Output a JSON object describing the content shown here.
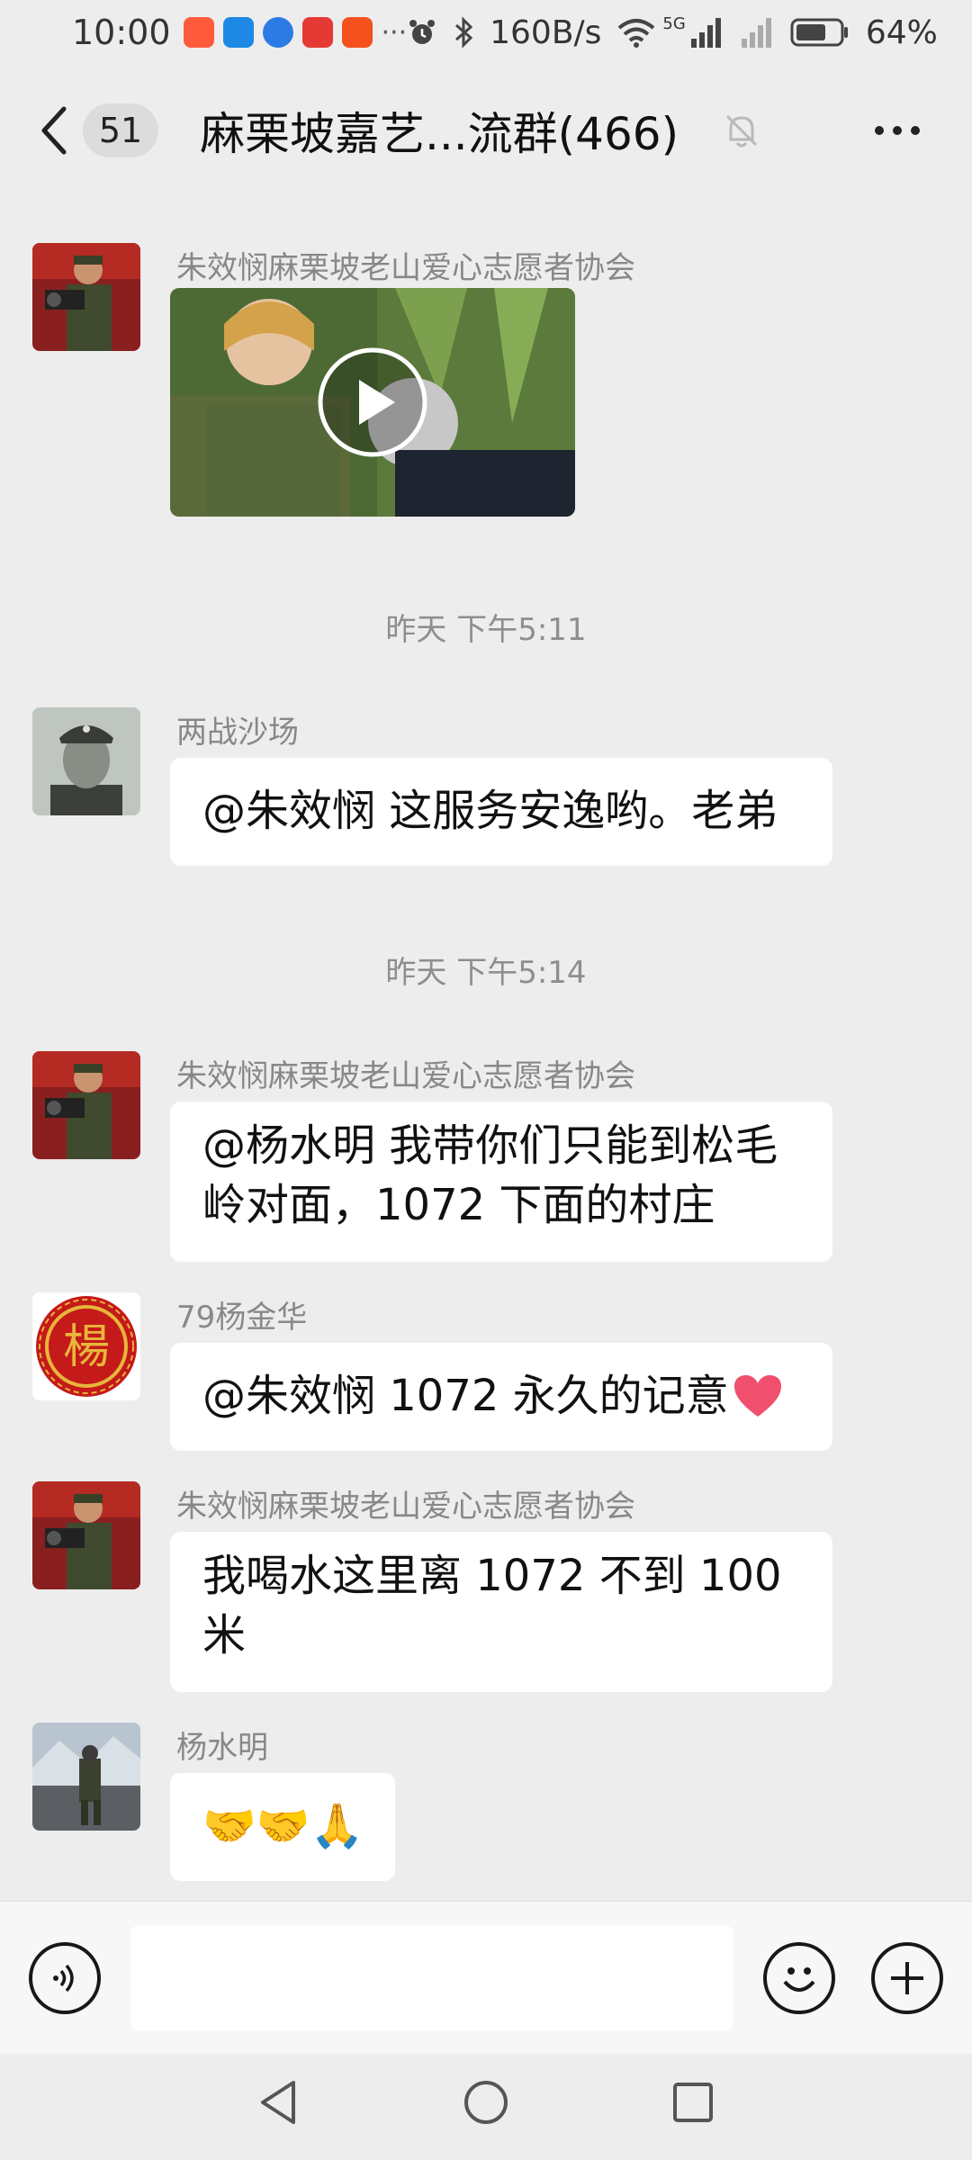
{
  "status_bar": {
    "time": "10:00",
    "more_indicator": "···",
    "network_speed": "160B/s",
    "network_type": "5G",
    "battery_percent": "64%",
    "app_icons": [
      "taobao-icon",
      "weather-icon",
      "browser-icon",
      "reader-icon",
      "video-app-icon"
    ]
  },
  "header": {
    "back_icon": "chevron-left-icon",
    "unread_count": "51",
    "title": "麻栗坡嘉艺...流群(466)",
    "mute_icon": "bell-muted-icon",
    "more_icon": "more-dots-icon"
  },
  "messages": [
    {
      "type": "video",
      "sender": "朱效悯麻栗坡老山爱心志愿者协会",
      "avatar": "soldier-with-camera-avatar"
    },
    {
      "type": "time",
      "text": "昨天 下午5:11"
    },
    {
      "type": "text",
      "sender": "两战沙场",
      "avatar": "bw-soldier-portrait-avatar",
      "lines": [
        "@朱效悯  这服务安逸哟。老弟"
      ]
    },
    {
      "type": "time",
      "text": "昨天 下午5:14"
    },
    {
      "type": "text",
      "sender": "朱效悯麻栗坡老山爱心志愿者协会",
      "avatar": "soldier-with-camera-avatar",
      "lines": [
        "@杨水明  我带你们只能到松毛",
        "岭对面，1072 下面的村庄"
      ]
    },
    {
      "type": "text",
      "sender": "79杨金华",
      "avatar": "yang-seal-avatar",
      "lines": [
        "@朱效悯  1072 永久的记意"
      ],
      "emoji": "heart"
    },
    {
      "type": "text",
      "sender": "朱效悯麻栗坡老山爱心志愿者协会",
      "avatar": "soldier-with-camera-avatar",
      "lines": [
        "我喝水这里离 1072 不到 100",
        "米"
      ]
    },
    {
      "type": "text",
      "sender": "杨水明",
      "avatar": "soldier-mountain-avatar",
      "lines": [
        "🤝🤝🙏"
      ]
    }
  ],
  "avatar_glyph": "楊",
  "input_bar": {
    "voice_icon": "voice-icon",
    "emoji_icon": "smiley-icon",
    "plus_icon": "plus-icon",
    "value": ""
  },
  "nav_bar": {
    "back": "nav-back-icon",
    "home": "nav-home-icon",
    "recents": "nav-recents-icon"
  },
  "colors": {
    "background": "#ededed",
    "bubble": "#ffffff",
    "muted_text": "#888888",
    "heart": "#f0506e"
  }
}
